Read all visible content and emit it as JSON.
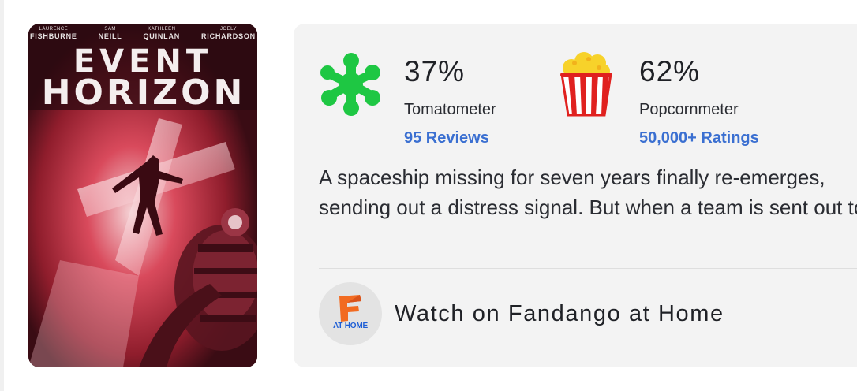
{
  "poster": {
    "cast": [
      {
        "first": "LAURENCE",
        "last": "FISHBURNE"
      },
      {
        "first": "SAM",
        "last": "NEILL"
      },
      {
        "first": "KATHLEEN",
        "last": "QUINLAN"
      },
      {
        "first": "JOELY",
        "last": "RICHARDSON"
      }
    ],
    "title_line1": "EVENT",
    "title_line2": "HORIZON"
  },
  "scores": {
    "tomatometer": {
      "percent": "37%",
      "label": "Tomatometer",
      "count": "95 Reviews",
      "icon": "splat-rotten-icon",
      "color": "#1ec743"
    },
    "popcornmeter": {
      "percent": "62%",
      "label": "Popcornmeter",
      "count": "50,000+ Ratings",
      "icon": "popcorn-bucket-icon",
      "color": "#e0211f"
    }
  },
  "synopsis": "A spaceship missing for seven years finally re-emerges, sending out a distress signal. But when a team is sent out to investigate",
  "watch": {
    "label": "Watch on Fandango at Home",
    "logo_text": "AT HOME",
    "icon": "fandango-at-home-icon",
    "brand_color": "#f26b21"
  },
  "colors": {
    "link": "#3a6fd1",
    "card_bg": "#f3f3f3"
  }
}
